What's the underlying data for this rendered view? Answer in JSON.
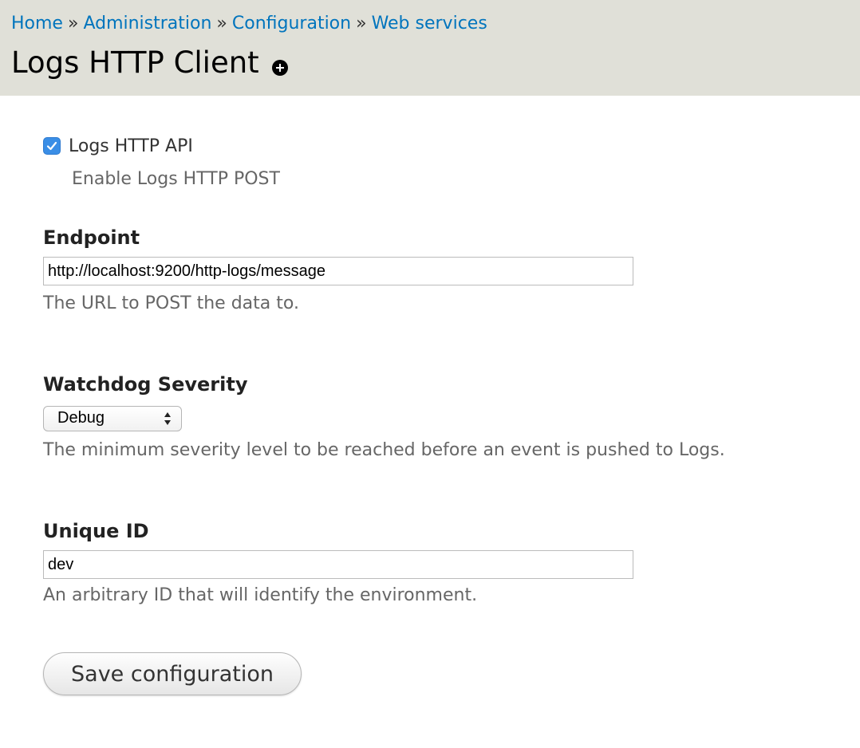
{
  "breadcrumb": {
    "items": [
      "Home",
      "Administration",
      "Configuration",
      "Web services"
    ],
    "separator": "»"
  },
  "page": {
    "title": "Logs HTTP Client",
    "shortcut_icon": "plus-circle-icon"
  },
  "form": {
    "enable": {
      "label": "Logs HTTP API",
      "description": "Enable Logs HTTP POST",
      "checked": true
    },
    "endpoint": {
      "label": "Endpoint",
      "value": "http://localhost:9200/http-logs/message",
      "description": "The URL to POST the data to."
    },
    "severity": {
      "label": "Watchdog Severity",
      "selected": "Debug",
      "description": "The minimum severity level to be reached before an event is pushed to Logs."
    },
    "unique_id": {
      "label": "Unique ID",
      "value": "dev",
      "description": "An arbitrary ID that will identify the environment."
    },
    "submit_label": "Save configuration"
  },
  "colors": {
    "header_bg": "#e0e0d8",
    "link": "#0074bd",
    "checkbox": "#3a8ee6"
  }
}
